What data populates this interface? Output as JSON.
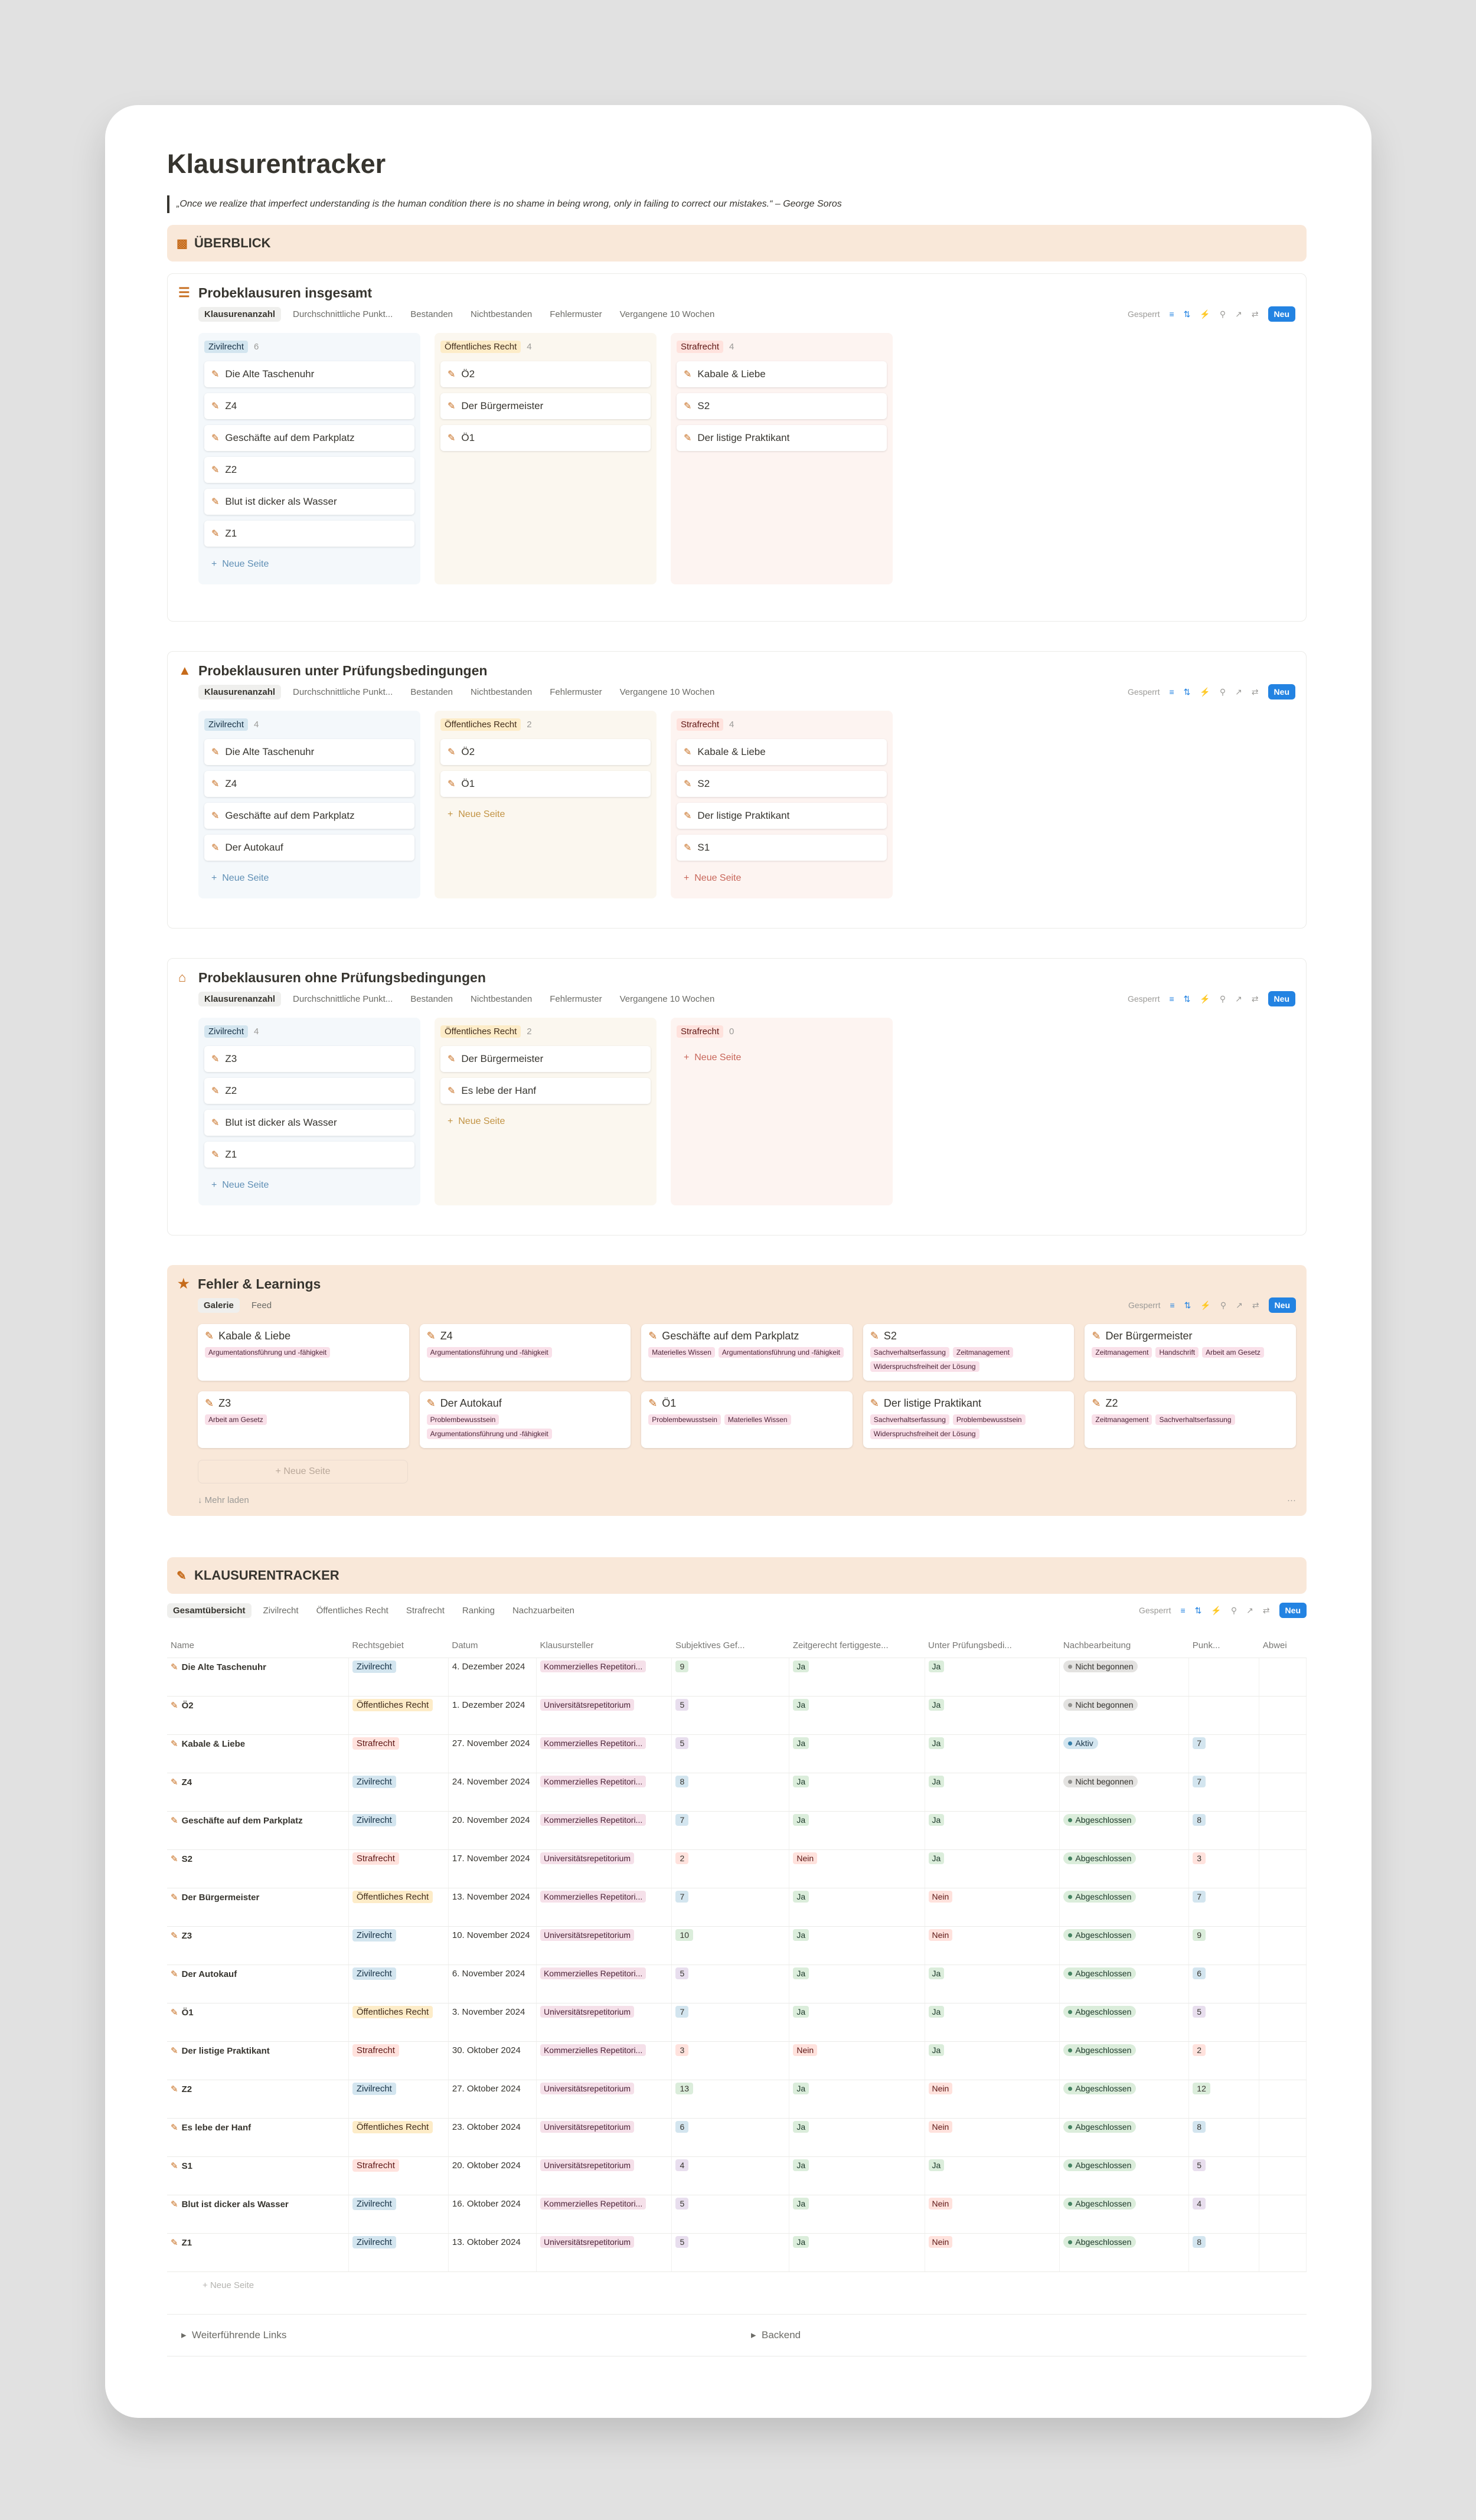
{
  "page": {
    "title": "Klausurentracker",
    "quote": "„Once we realize that imperfect understanding is the human condition there is no shame in being wrong, only in failing to correct our mistakes.“ – George Soros"
  },
  "overview_callout": "ÜBERBLICK",
  "view_tabs": [
    "Klausurenanzahl",
    "Durchschnittliche Punkt...",
    "Bestanden",
    "Nichtbestanden",
    "Fehlermuster",
    "Vergangene 10 Wochen"
  ],
  "toolbar": {
    "locked": "Gesperrt",
    "new": "Neu"
  },
  "add_label": "Neue Seite",
  "boards": [
    {
      "title": "Probeklausuren insgesamt",
      "columns": [
        {
          "name": "Zivilrecht",
          "count": "6",
          "cards": [
            "Die Alte Taschenuhr",
            "Z4",
            "Geschäfte auf dem Parkplatz",
            "Z2",
            "Blut ist dicker als Wasser",
            "Z1"
          ],
          "add": true
        },
        {
          "name": "Öffentliches Recht",
          "count": "4",
          "cards": [
            "Ö2",
            "Der Bürgermeister",
            "Ö1"
          ],
          "add": false
        },
        {
          "name": "Strafrecht",
          "count": "4",
          "cards": [
            "Kabale & Liebe",
            "S2",
            "Der listige Praktikant"
          ],
          "add": false
        }
      ]
    },
    {
      "title": "Probeklausuren unter Prüfungsbedingungen",
      "columns": [
        {
          "name": "Zivilrecht",
          "count": "4",
          "cards": [
            "Die Alte Taschenuhr",
            "Z4",
            "Geschäfte auf dem Parkplatz",
            "Der Autokauf"
          ],
          "add": true
        },
        {
          "name": "Öffentliches Recht",
          "count": "2",
          "cards": [
            "Ö2",
            "Ö1"
          ],
          "add": true
        },
        {
          "name": "Strafrecht",
          "count": "4",
          "cards": [
            "Kabale & Liebe",
            "S2",
            "Der listige Praktikant",
            "S1"
          ],
          "add": true
        }
      ]
    },
    {
      "title": "Probeklausuren ohne Prüfungsbedingungen",
      "columns": [
        {
          "name": "Zivilrecht",
          "count": "4",
          "cards": [
            "Z3",
            "Z2",
            "Blut ist dicker als Wasser",
            "Z1"
          ],
          "add": true
        },
        {
          "name": "Öffentliches Recht",
          "count": "2",
          "cards": [
            "Der Bürgermeister",
            "Es lebe der Hanf"
          ],
          "add": true
        },
        {
          "name": "Strafrecht",
          "count": "0",
          "cards": [],
          "add": true
        }
      ]
    }
  ],
  "fehler": {
    "title": "Fehler & Learnings",
    "tabs": [
      "Galerie",
      "Feed"
    ],
    "cards": [
      {
        "title": "Kabale & Liebe",
        "tags": [
          "Argumentationsführung und -fähigkeit"
        ]
      },
      {
        "title": "Z4",
        "tags": [
          "Argumentationsführung und -fähigkeit"
        ]
      },
      {
        "title": "Geschäfte auf dem Parkplatz",
        "tags": [
          "Materielles Wissen",
          "Argumentationsführung und -fähigkeit"
        ]
      },
      {
        "title": "S2",
        "tags": [
          "Sachverhaltserfassung",
          "Zeitmanagement",
          "Widerspruchsfreiheit der Lösung"
        ]
      },
      {
        "title": "Der Bürgermeister",
        "tags": [
          "Zeitmanagement",
          "Handschrift",
          "Arbeit am Gesetz"
        ]
      },
      {
        "title": "Z3",
        "tags": [
          "Arbeit am Gesetz"
        ]
      },
      {
        "title": "Der Autokauf",
        "tags": [
          "Problembewusstsein",
          "Argumentationsführung und -fähigkeit"
        ]
      },
      {
        "title": "Ö1",
        "tags": [
          "Problembewusstsein",
          "Materielles Wissen"
        ]
      },
      {
        "title": "Der listige Praktikant",
        "tags": [
          "Sachverhaltserfassung",
          "Problembewusstsein",
          "Widerspruchsfreiheit der Lösung"
        ]
      },
      {
        "title": "Z2",
        "tags": [
          "Zeitmanagement",
          "Sachverhaltserfassung"
        ]
      }
    ],
    "more": "Mehr laden",
    "more_menu": "···"
  },
  "tracker": {
    "title": "KLAUSURENTRACKER",
    "tabs": [
      "Gesamtübersicht",
      "Zivilrecht",
      "Öffentliches Recht",
      "Strafrecht",
      "Ranking",
      "Nachzuarbeiten"
    ],
    "columns": [
      "Name",
      "Rechtsgebiet",
      "Datum",
      "Klausursteller",
      "Subjektives Gef...",
      "Zeitgerecht fertiggeste...",
      "Unter Prüfungsbedi...",
      "Nachbearbeitung",
      "Punk...",
      "Abwei"
    ],
    "rows": [
      [
        "Die Alte Taschenuhr",
        "Zivilrecht",
        "4. Dezember 2024",
        "Kommerzielles Repetitori...",
        "9",
        "Ja",
        "Ja",
        "Nicht begonnen",
        ""
      ],
      [
        "Ö2",
        "Öffentliches Recht",
        "1. Dezember 2024",
        "Universitätsrepetitorium",
        "5",
        "Ja",
        "Ja",
        "Nicht begonnen",
        ""
      ],
      [
        "Kabale & Liebe",
        "Strafrecht",
        "27. November 2024",
        "Kommerzielles Repetitori...",
        "5",
        "Ja",
        "Ja",
        "Aktiv",
        "7"
      ],
      [
        "Z4",
        "Zivilrecht",
        "24. November 2024",
        "Kommerzielles Repetitori...",
        "8",
        "Ja",
        "Ja",
        "Nicht begonnen",
        "7"
      ],
      [
        "Geschäfte auf dem Parkplatz",
        "Zivilrecht",
        "20. November 2024",
        "Kommerzielles Repetitori...",
        "7",
        "Ja",
        "Ja",
        "Abgeschlossen",
        "8"
      ],
      [
        "S2",
        "Strafrecht",
        "17. November 2024",
        "Universitätsrepetitorium",
        "2",
        "Nein",
        "Ja",
        "Abgeschlossen",
        "3"
      ],
      [
        "Der Bürgermeister",
        "Öffentliches Recht",
        "13. November 2024",
        "Kommerzielles Repetitori...",
        "7",
        "Ja",
        "Nein",
        "Abgeschlossen",
        "7"
      ],
      [
        "Z3",
        "Zivilrecht",
        "10. November 2024",
        "Universitätsrepetitorium",
        "10",
        "Ja",
        "Nein",
        "Abgeschlossen",
        "9"
      ],
      [
        "Der Autokauf",
        "Zivilrecht",
        "6. November 2024",
        "Kommerzielles Repetitori...",
        "5",
        "Ja",
        "Ja",
        "Abgeschlossen",
        "6"
      ],
      [
        "Ö1",
        "Öffentliches Recht",
        "3. November 2024",
        "Universitätsrepetitorium",
        "7",
        "Ja",
        "Ja",
        "Abgeschlossen",
        "5"
      ],
      [
        "Der listige Praktikant",
        "Strafrecht",
        "30. Oktober 2024",
        "Kommerzielles Repetitori...",
        "3",
        "Nein",
        "Ja",
        "Abgeschlossen",
        "2"
      ],
      [
        "Z2",
        "Zivilrecht",
        "27. Oktober 2024",
        "Universitätsrepetitorium",
        "13",
        "Ja",
        "Nein",
        "Abgeschlossen",
        "12"
      ],
      [
        "Es lebe der Hanf",
        "Öffentliches Recht",
        "23. Oktober 2024",
        "Universitätsrepetitorium",
        "6",
        "Ja",
        "Nein",
        "Abgeschlossen",
        "8"
      ],
      [
        "S1",
        "Strafrecht",
        "20. Oktober 2024",
        "Universitätsrepetitorium",
        "4",
        "Ja",
        "Ja",
        "Abgeschlossen",
        "5"
      ],
      [
        "Blut ist dicker als Wasser",
        "Zivilrecht",
        "16. Oktober 2024",
        "Kommerzielles Repetitori...",
        "5",
        "Ja",
        "Nein",
        "Abgeschlossen",
        "4"
      ],
      [
        "Z1",
        "Zivilrecht",
        "13. Oktober 2024",
        "Universitätsrepetitorium",
        "5",
        "Ja",
        "Nein",
        "Abgeschlossen",
        "8"
      ]
    ]
  },
  "footer": {
    "left": "Weiterführende Links",
    "right": "Backend"
  }
}
